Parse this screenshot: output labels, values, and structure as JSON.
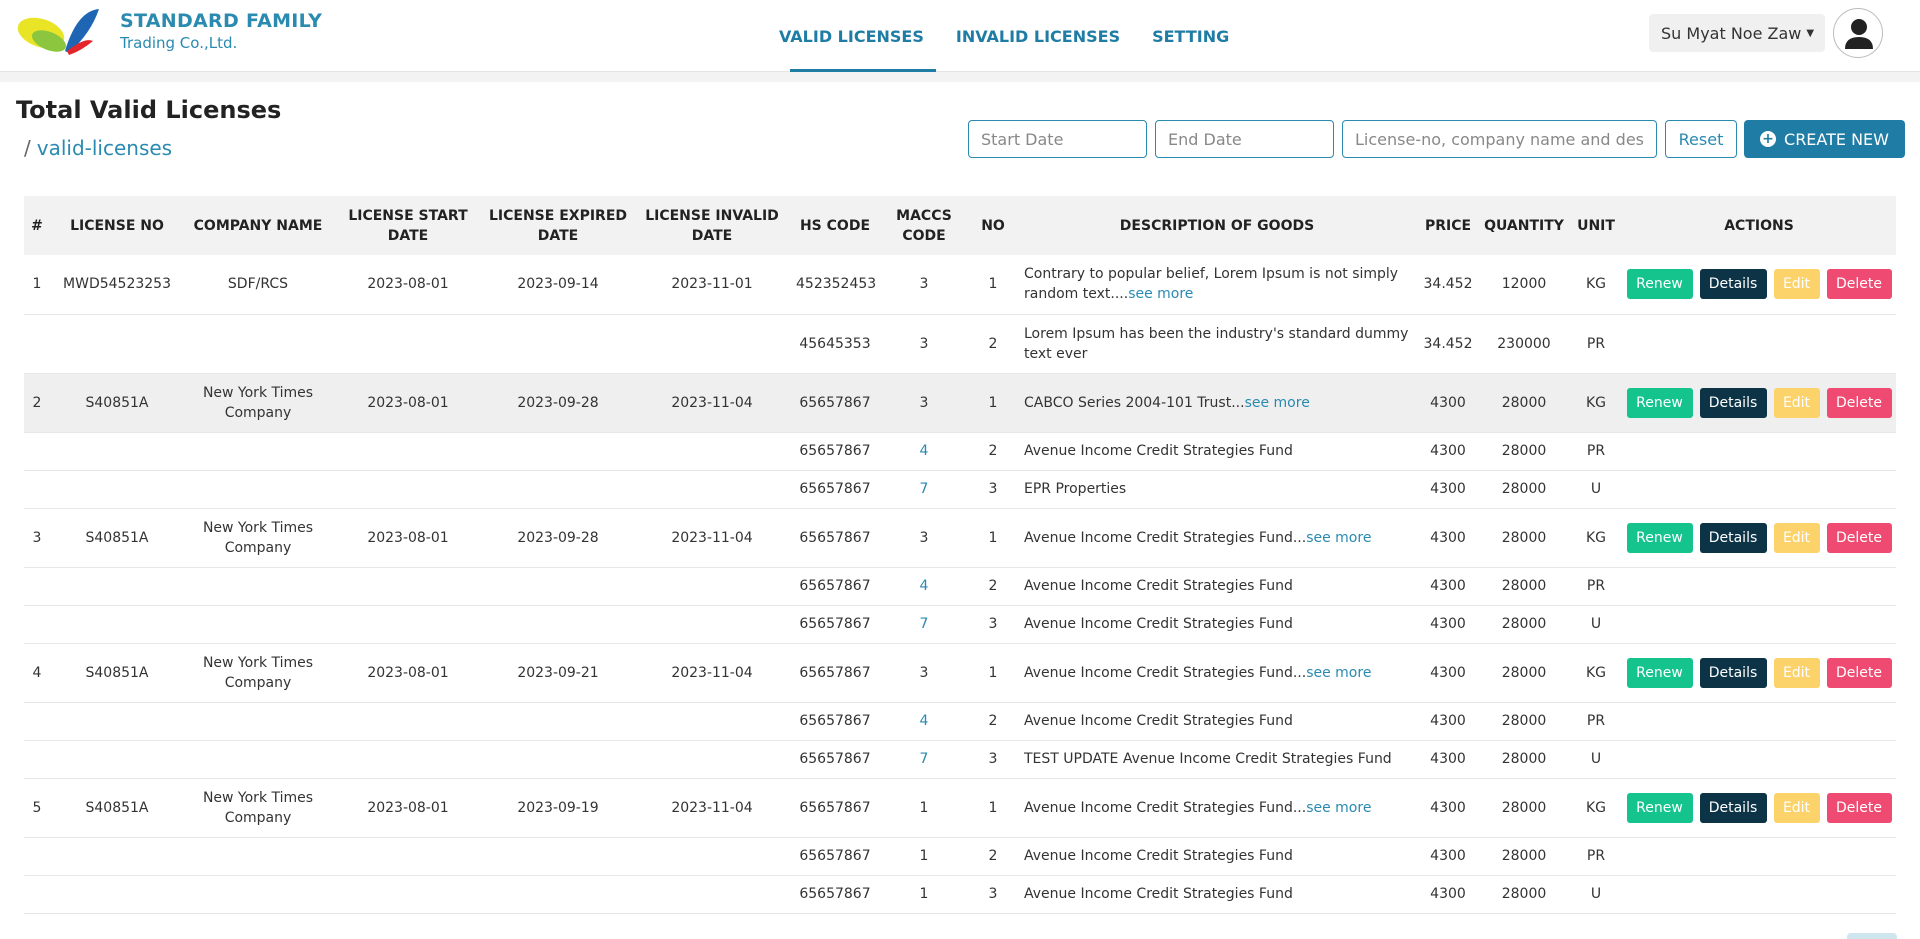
{
  "brand": {
    "name": "STANDARD FAMILY",
    "sub": "Trading Co.,Ltd."
  },
  "nav": [
    {
      "label": "VALID LICENSES",
      "active": true
    },
    {
      "label": "INVALID LICENSES",
      "active": false
    },
    {
      "label": "SETTING",
      "active": false
    }
  ],
  "user": {
    "name": "Su Myat Noe Zaw"
  },
  "page": {
    "title": "Total Valid Licenses",
    "breadcrumb_sep": "/",
    "breadcrumb": "valid-licenses"
  },
  "filters": {
    "start_placeholder": "Start Date",
    "end_placeholder": "End Date",
    "search_placeholder": "License-no, company name and description",
    "reset_label": "Reset",
    "create_label": "CREATE NEW"
  },
  "table": {
    "headers": [
      "#",
      "LICENSE NO",
      "COMPANY NAME",
      "LICENSE START DATE",
      "LICENSE EXPIRED DATE",
      "LICENSE INVALID DATE",
      "HS CODE",
      "MACCS CODE",
      "NO",
      "DESCRIPTION OF GOODS",
      "PRICE",
      "QUANTITY",
      "UNIT",
      "ACTIONS"
    ],
    "actions": {
      "renew": "Renew",
      "details": "Details",
      "edit": "Edit",
      "delete": "Delete"
    },
    "see_more": "see more",
    "licenses": [
      {
        "idx": "1",
        "license_no": "MWD54523253",
        "company": "SDF/RCS",
        "start": "2023-08-01",
        "expired": "2023-09-14",
        "invalid": "2023-11-01",
        "items": [
          {
            "hs": "452352453",
            "maccs": "3",
            "no": "1",
            "desc": "Contrary to popular belief, Lorem Ipsum is not simply random text....",
            "more": true,
            "price": "34.452",
            "qty": "12000",
            "unit": "KG"
          },
          {
            "hs": "45645353",
            "maccs": "3",
            "no": "2",
            "desc": "Lorem Ipsum has been the industry's standard dummy text ever",
            "more": false,
            "price": "34.452",
            "qty": "230000",
            "unit": "PR"
          }
        ]
      },
      {
        "idx": "2",
        "license_no": "S40851A",
        "company": "New York Times Company",
        "start": "2023-08-01",
        "expired": "2023-09-28",
        "invalid": "2023-11-04",
        "items": [
          {
            "hs": "65657867",
            "maccs": "3",
            "no": "1",
            "desc": "CABCO Series 2004-101 Trust...",
            "more": true,
            "price": "4300",
            "qty": "28000",
            "unit": "KG"
          },
          {
            "hs": "65657867",
            "maccs": "4",
            "no": "2",
            "desc": "Avenue Income Credit Strategies Fund",
            "more": false,
            "price": "4300",
            "qty": "28000",
            "unit": "PR"
          },
          {
            "hs": "65657867",
            "maccs": "7",
            "no": "3",
            "desc": "EPR Properties",
            "more": false,
            "price": "4300",
            "qty": "28000",
            "unit": "U"
          }
        ]
      },
      {
        "idx": "3",
        "license_no": "S40851A",
        "company": "New York Times Company",
        "start": "2023-08-01",
        "expired": "2023-09-28",
        "invalid": "2023-11-04",
        "items": [
          {
            "hs": "65657867",
            "maccs": "3",
            "no": "1",
            "desc": "Avenue Income Credit Strategies Fund...",
            "more": true,
            "price": "4300",
            "qty": "28000",
            "unit": "KG"
          },
          {
            "hs": "65657867",
            "maccs": "4",
            "no": "2",
            "desc": "Avenue Income Credit Strategies Fund",
            "more": false,
            "price": "4300",
            "qty": "28000",
            "unit": "PR"
          },
          {
            "hs": "65657867",
            "maccs": "7",
            "no": "3",
            "desc": "Avenue Income Credit Strategies Fund",
            "more": false,
            "price": "4300",
            "qty": "28000",
            "unit": "U"
          }
        ]
      },
      {
        "idx": "4",
        "license_no": "S40851A",
        "company": "New York Times Company",
        "start": "2023-08-01",
        "expired": "2023-09-21",
        "invalid": "2023-11-04",
        "items": [
          {
            "hs": "65657867",
            "maccs": "3",
            "no": "1",
            "desc": "Avenue Income Credit Strategies Fund...",
            "more": true,
            "price": "4300",
            "qty": "28000",
            "unit": "KG"
          },
          {
            "hs": "65657867",
            "maccs": "4",
            "no": "2",
            "desc": "Avenue Income Credit Strategies Fund",
            "more": false,
            "price": "4300",
            "qty": "28000",
            "unit": "PR"
          },
          {
            "hs": "65657867",
            "maccs": "7",
            "no": "3",
            "desc": "TEST UPDATE Avenue Income Credit Strategies Fund",
            "more": false,
            "price": "4300",
            "qty": "28000",
            "unit": "U"
          }
        ]
      },
      {
        "idx": "5",
        "license_no": "S40851A",
        "company": "New York Times Company",
        "start": "2023-08-01",
        "expired": "2023-09-19",
        "invalid": "2023-11-04",
        "items": [
          {
            "hs": "65657867",
            "maccs": "1",
            "no": "1",
            "desc": "Avenue Income Credit Strategies Fund...",
            "more": true,
            "price": "4300",
            "qty": "28000",
            "unit": "KG"
          },
          {
            "hs": "65657867",
            "maccs": "1",
            "no": "2",
            "desc": "Avenue Income Credit Strategies Fund",
            "more": false,
            "price": "4300",
            "qty": "28000",
            "unit": "PR"
          },
          {
            "hs": "65657867",
            "maccs": "1",
            "no": "3",
            "desc": "Avenue Income Credit Strategies Fund",
            "more": false,
            "price": "4300",
            "qty": "28000",
            "unit": "U"
          }
        ]
      }
    ]
  },
  "colors": {
    "primary": "#1f7ca4",
    "renew": "#14c48c",
    "details": "#0c3446",
    "edit": "#fcd36b",
    "delete": "#ef4b72"
  }
}
